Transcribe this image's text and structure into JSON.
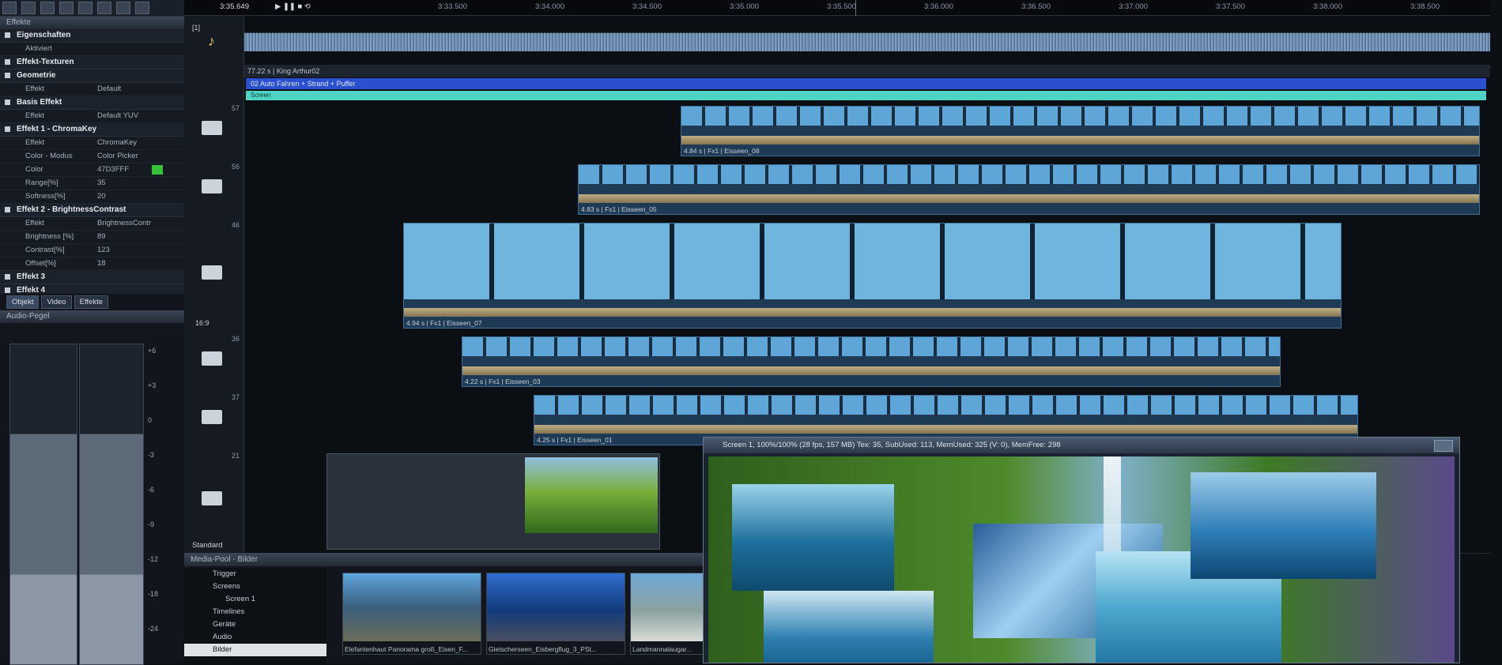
{
  "left_panel": {
    "effects_header": "Effekte",
    "sections": [
      {
        "title": "Eigenschaften",
        "props": [
          {
            "key": "Aktiviert",
            "value": ""
          }
        ]
      },
      {
        "title": "Effekt-Texturen",
        "props": []
      },
      {
        "title": "Geometrie",
        "props": [
          {
            "key": "Effekt",
            "value": "Default"
          }
        ]
      },
      {
        "title": "Basis Effekt",
        "props": [
          {
            "key": "Effekt",
            "value": "Default YUV"
          }
        ]
      },
      {
        "title": "Effekt 1 - ChromaKey",
        "props": [
          {
            "key": "Effekt",
            "value": "ChromaKey"
          },
          {
            "key": "Color - Modus",
            "value": "Color Picker"
          },
          {
            "key": "Color",
            "value": "47D3FFF"
          },
          {
            "key": "Range[%]",
            "value": "35"
          },
          {
            "key": "Softness[%]",
            "value": "20"
          }
        ]
      },
      {
        "title": "Effekt 2 - BrightnessContrast",
        "props": [
          {
            "key": "Effekt",
            "value": "BrightnessContr"
          },
          {
            "key": "Brightness [%]",
            "value": "89"
          },
          {
            "key": "Contrast[%]",
            "value": "123"
          },
          {
            "key": "Offset[%]",
            "value": "18"
          }
        ]
      },
      {
        "title": "Effekt 3",
        "props": []
      },
      {
        "title": "Effekt 4",
        "props": []
      }
    ],
    "tabs": [
      "Objekt",
      "Video",
      "Effekte"
    ],
    "audio_header": "Audio-Pegel",
    "meter_scale": [
      "+6",
      "+3",
      "0",
      "-3",
      "-6",
      "-9",
      "-12",
      "-18",
      "-24"
    ]
  },
  "ruler": {
    "current": "3:35.649",
    "labels": [
      "3:33.500",
      "3:34.000",
      "3:34.500",
      "3:35.000",
      "3:35.500",
      "3:36.000",
      "3:36.500",
      "3:37.000",
      "3:37.500",
      "3:38.000",
      "3:38.500"
    ]
  },
  "tracks": {
    "audio_number": "[1]",
    "audio_label": "77.22 s | King Arthur02",
    "blue_label": "02 Auto Fahren + Strand + Puffer",
    "teal_label": "Screen",
    "video": [
      {
        "num": "57",
        "label": "4.84 s | Fx1 | Eisseen_08"
      },
      {
        "num": "56",
        "label": "4.83 s | Fx1 | Eisseen_05"
      },
      {
        "num": "46",
        "label": "4.94 s | Fx1 | Eisseen_07",
        "aspect": "16:9"
      },
      {
        "num": "36",
        "label": "4.22 s | Fx1 | Eisseen_03"
      },
      {
        "num": "37",
        "label": "4.25 s | Fx1 | Eisseen_01"
      },
      {
        "num": "21",
        "label": "",
        "mode": "Standard"
      }
    ]
  },
  "media_pool": {
    "header": "Media-Pool - Bilder",
    "tree": [
      "Trigger",
      "Screens",
      "Screen 1",
      "Timelines",
      "Geräte",
      "Audio",
      "Bilder"
    ],
    "thumbs": [
      "Elefantenhaut Panorama groß_Eisen_F...",
      "Gletscherseen_Eisbergflug_3_PSt...",
      "Landmannalaugar..."
    ]
  },
  "preview": {
    "title": "Screen 1, 100%/100% (28 fps, 157 MB)  Tex: 35, SubUsed: 113, MemUsed: 325 (V: 0), MemFree: 298"
  }
}
